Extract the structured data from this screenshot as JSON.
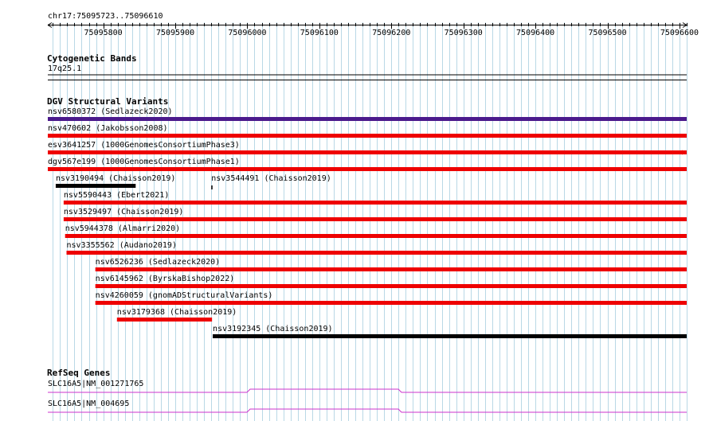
{
  "ruler": {
    "location": "chr17:75095723..75096610",
    "start": 75095723,
    "end": 75096610,
    "tick_labels": [
      "75095800",
      "75095900",
      "75096000",
      "75096100",
      "75096200",
      "75096300",
      "75096400",
      "75096500",
      "75096600"
    ]
  },
  "cytoband": {
    "title": "Cytogenetic Bands",
    "band": "17q25.1"
  },
  "dgv": {
    "title": "DGV Structural Variants",
    "items": [
      {
        "label": "nsv6580372 (Sedlazeck2020)",
        "color": "#4b1a8c",
        "from": 75095723,
        "to": 75096610,
        "arrow": false
      },
      {
        "label": "nsv470602 (Jakobsson2008)",
        "color": "#ee0000",
        "from": 75095723,
        "to": 75096610,
        "arrow": false
      },
      {
        "label": "esv3641257 (1000GenomesConsortiumPhase3)",
        "color": "#ee0000",
        "from": 75095723,
        "to": 75096610,
        "arrow": true
      },
      {
        "label": "dgv567e199 (1000GenomesConsortiumPhase1)",
        "color": "#ee0000",
        "from": 75095723,
        "to": 75096610,
        "arrow": false
      },
      {
        "label": "nsv3190494 (Chaisson2019)",
        "color": "#000000",
        "from": 75095734,
        "to": 75095845,
        "arrow": false
      },
      {
        "label": "nsv3544491 (Chaisson2019)",
        "color": "#000000",
        "from": 75095950,
        "to": 75095951,
        "arrow": false
      },
      {
        "label": "nsv5590443 (Ebert2021)",
        "color": "#ee0000",
        "from": 75095745,
        "to": 75096610,
        "arrow": false
      },
      {
        "label": "nsv3529497 (Chaisson2019)",
        "color": "#ee0000",
        "from": 75095745,
        "to": 75096610,
        "arrow": false
      },
      {
        "label": "nsv5944378 (Almarri2020)",
        "color": "#ee0000",
        "from": 75095747,
        "to": 75096610,
        "arrow": false
      },
      {
        "label": "nsv3355562 (Audano2019)",
        "color": "#ee0000",
        "from": 75095749,
        "to": 75096610,
        "arrow": false
      },
      {
        "label": "nsv6526236 (Sedlazeck2020)",
        "color": "#ee0000",
        "from": 75095789,
        "to": 75096610,
        "arrow": false
      },
      {
        "label": "nsv6145962 (ByrskaBishop2022)",
        "color": "#ee0000",
        "from": 75095789,
        "to": 75096610,
        "arrow": false
      },
      {
        "label": "nsv4260059 (gnomADStructuralVariants)",
        "color": "#ee0000",
        "from": 75095789,
        "to": 75096610,
        "arrow": false
      },
      {
        "label": "nsv3179368 (Chaisson2019)",
        "color": "#ee0000",
        "from": 75095819,
        "to": 75095951,
        "arrow": false
      },
      {
        "label": "nsv3192345 (Chaisson2019)",
        "color": "#000000",
        "from": 75095952,
        "to": 75096610,
        "arrow": false
      }
    ]
  },
  "refseq": {
    "title": "RefSeq Genes",
    "genes": [
      {
        "label": "SLC16A5|NM_001271765",
        "color": "#cc33cc"
      },
      {
        "label": "SLC16A5|NM_004695",
        "color": "#cc33cc"
      }
    ]
  }
}
